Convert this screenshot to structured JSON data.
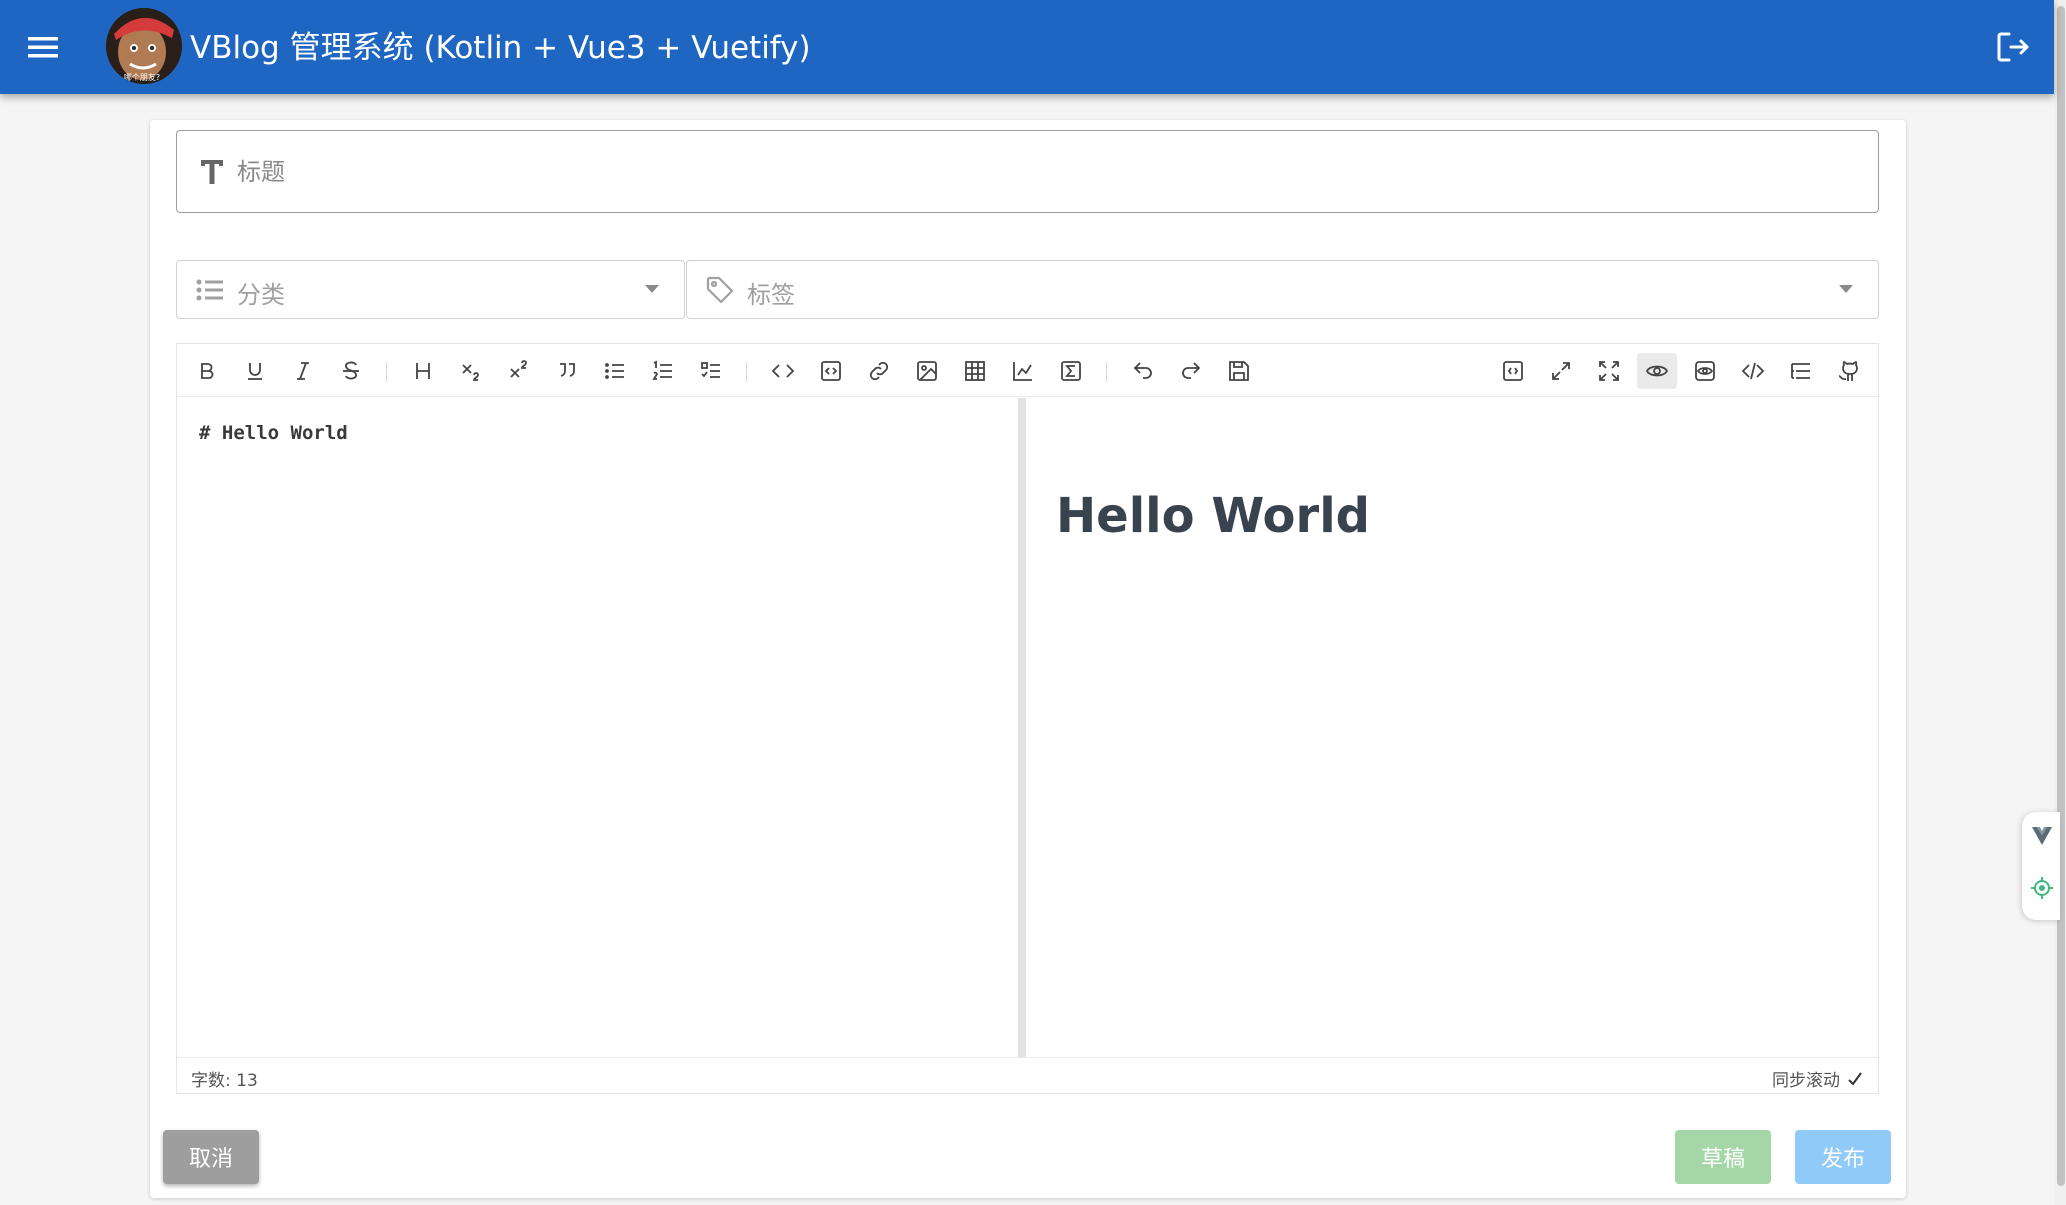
{
  "app": {
    "title": "VBlog 管理系统 (Kotlin + Vue3 + Vuetify)",
    "avatar_caption": "哪个朋友?"
  },
  "form": {
    "title_placeholder": "标题",
    "category_label": "分类",
    "tags_label": "标签"
  },
  "editor": {
    "toolbar_left": [
      "bold-icon",
      "underline-icon",
      "italic-icon",
      "strikethrough-icon",
      "heading-icon",
      "subscript-icon",
      "superscript-icon",
      "quote-icon",
      "unordered-list-icon",
      "ordered-list-icon",
      "task-list-icon",
      "inline-code-icon",
      "code-block-icon",
      "link-icon",
      "image-icon",
      "table-icon",
      "chart-icon",
      "formula-icon",
      "undo-icon",
      "redo-icon",
      "save-icon"
    ],
    "toolbar_right": [
      "page-fullscreen-icon",
      "fullscreen-icon",
      "fullscreen-expand-icon",
      "preview-icon",
      "preview-only-icon",
      "html-preview-icon",
      "catalog-icon",
      "github-icon"
    ],
    "active_tool": "preview-icon",
    "content": "# Hello World",
    "preview_heading": "Hello World",
    "word_count_label": "字数: 13",
    "sync_scroll_label": "同步滚动",
    "sync_scroll_checked": true
  },
  "actions": {
    "cancel": "取消",
    "draft": "草稿",
    "publish": "发布"
  },
  "colors": {
    "appbar": "#1e66c1",
    "cancel": "#9e9e9e",
    "draft": "#a5d6a7",
    "publish": "#90caf9"
  }
}
